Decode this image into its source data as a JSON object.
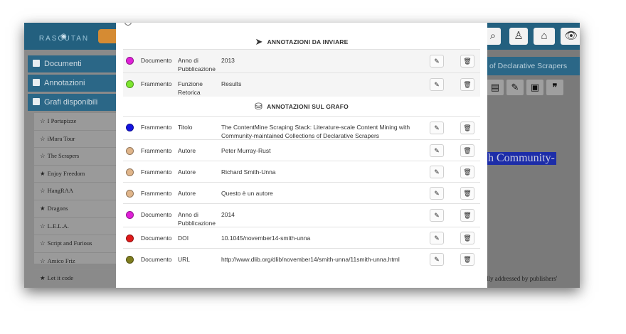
{
  "app": {
    "logo_text": "RASCUTAN",
    "doc_title": "of Declarative Scrapers",
    "doc_highlight": "h Community-",
    "doc_text_line1": "lly addressed by publishers'",
    "doc_text_line2": "…"
  },
  "sidebar": {
    "headers": [
      "Documenti",
      "Annotazioni",
      "Grafi disponibili"
    ],
    "graphs": [
      {
        "star": "☆",
        "name": "I Portapizze"
      },
      {
        "star": "☆",
        "name": "iMura Tour"
      },
      {
        "star": "☆",
        "name": "The Scrapers"
      },
      {
        "star": "★",
        "name": "Enjoy Freedom"
      },
      {
        "star": "☆",
        "name": "HangRAA"
      },
      {
        "star": "★",
        "name": "Dragons"
      },
      {
        "star": "☆",
        "name": "L.E.L.A."
      },
      {
        "star": "☆",
        "name": "Script and Furious"
      },
      {
        "star": "☆",
        "name": "Amico Friz"
      },
      {
        "star": "★",
        "name": "Let it code"
      }
    ]
  },
  "toolbar_icons": [
    "search-icon",
    "user-icon",
    "home-icon",
    "eye-icon"
  ],
  "doc_tools_icons": [
    "document-icon",
    "edit-icon",
    "save-icon",
    "quote-icon"
  ],
  "modal": {
    "section_to_send": {
      "icon": "paper-plane-icon",
      "title": "ANNOTAZIONI DA INVIARE"
    },
    "to_send": [
      {
        "color": "#e020d8",
        "type": "Documento",
        "property": "Anno di Pubblicazione",
        "value": "2013"
      },
      {
        "color": "#7de62f",
        "type": "Frammento",
        "property": "Funzione Retorica",
        "value": "Results"
      }
    ],
    "section_graph": {
      "icon": "hard-drive-icon",
      "title": "ANNOTAZIONI SUL GRAFO"
    },
    "graph": [
      {
        "color": "#1414e0",
        "type": "Frammento",
        "property": "Titolo",
        "value": "The ContentMine Scraping Stack: Literature-scale Content Mining with Community-maintained Collections of Declarative Scrapers"
      },
      {
        "color": "#e0b58a",
        "type": "Frammento",
        "property": "Autore",
        "value": "Peter Murray-Rust"
      },
      {
        "color": "#e0b58a",
        "type": "Frammento",
        "property": "Autore",
        "value": "Richard Smith-Unna"
      },
      {
        "color": "#e0b58a",
        "type": "Frammento",
        "property": "Autore",
        "value": "Questo è un autore"
      },
      {
        "color": "#e020d8",
        "type": "Documento",
        "property": "Anno di Pubblicazione",
        "value": "2014"
      },
      {
        "color": "#e01a1a",
        "type": "Documento",
        "property": "DOI",
        "value": "10.1045/november14-smith-unna"
      },
      {
        "color": "#7f7d1e",
        "type": "Documento",
        "property": "URL",
        "value": "http://www.dlib.org/dlib/november14/smith-unna/11smith-unna.html"
      }
    ],
    "edit_glyph": "✎",
    "delete_glyph": "🗑"
  }
}
